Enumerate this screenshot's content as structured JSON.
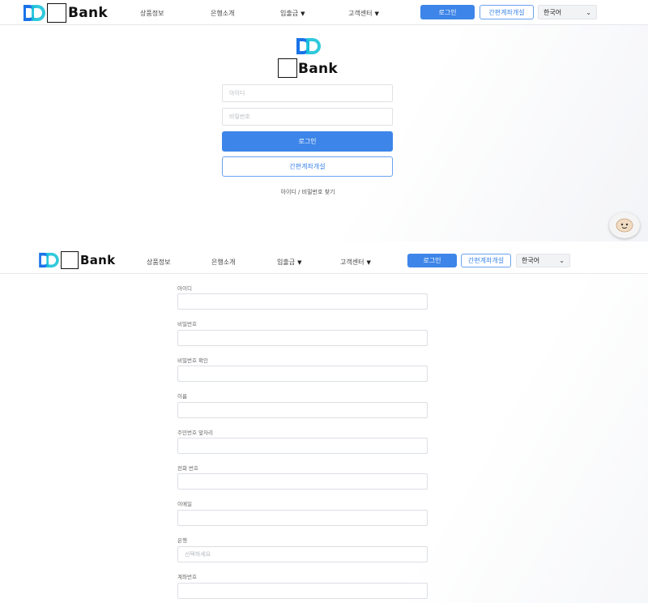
{
  "logo": {
    "text": "Bank",
    "colors": [
      "#1a73e8",
      "#19c3d8",
      "#0d47a1"
    ]
  },
  "nav": {
    "menu": [
      {
        "label": "상품정보",
        "dropdown": false
      },
      {
        "label": "은행소개",
        "dropdown": false
      },
      {
        "label": "입출금",
        "dropdown": true
      },
      {
        "label": "고객센터",
        "dropdown": true
      }
    ],
    "login_label": "로그인",
    "open_account_label": "간편계좌개설",
    "language": "한국어"
  },
  "login": {
    "id_placeholder": "아이디",
    "password_placeholder": "비밀번호",
    "login_button": "로그인",
    "open_account_button": "간편계좌개설",
    "find_link": "아이디 / 비밀번호 찾기"
  },
  "signup": {
    "fields": [
      {
        "label": "아이디",
        "placeholder": ""
      },
      {
        "label": "비밀번호",
        "placeholder": ""
      },
      {
        "label": "비밀번호 확인",
        "placeholder": ""
      },
      {
        "label": "이름",
        "placeholder": ""
      },
      {
        "label": "주민번호 앞자리",
        "placeholder": ""
      },
      {
        "label": "전화 번호",
        "placeholder": ""
      },
      {
        "label": "이메일",
        "placeholder": ""
      },
      {
        "label": "은행",
        "placeholder": "선택하세요"
      },
      {
        "label": "계좌번호",
        "placeholder": ""
      }
    ]
  },
  "theme": {
    "accent": "#3d85e8",
    "border": "#dfe1e5"
  },
  "icons": {
    "chat": "chat-bot-icon",
    "logo": "dd-logo-icon"
  }
}
